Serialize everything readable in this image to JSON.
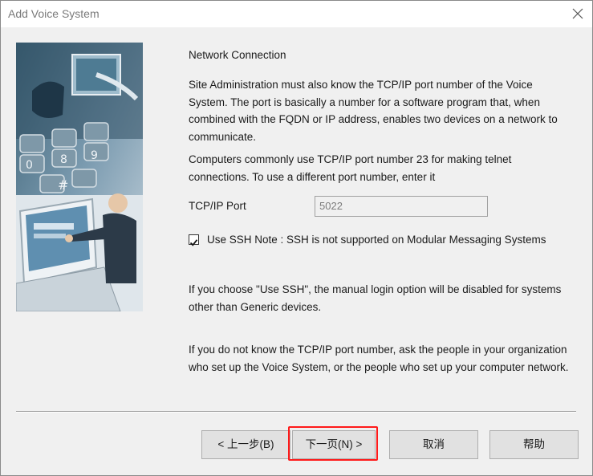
{
  "window": {
    "title": "Add Voice System",
    "close_icon": "close-icon"
  },
  "content": {
    "heading": "Network Connection",
    "paragraph1": "Site Administration must also know the TCP/IP port number of the Voice System.  The port is basically a number for a software program that, when combined with the FQDN or IP address, enables two devices on a network to communicate.",
    "paragraph2": "Computers commonly use TCP/IP port number 23 for making telnet connections.  To use a different port number, enter it",
    "port_label": "TCP/IP Port",
    "port_value": "5022",
    "ssh_checked": true,
    "ssh_label": "Use SSH Note : SSH is not supported on Modular Messaging Systems",
    "paragraph3": "If you choose \"Use SSH\", the manual login option will be disabled for systems other than Generic devices.",
    "paragraph4": "If you do not know the TCP/IP port number, ask the people in your organization who set up the Voice System, or the people who set up your computer network."
  },
  "buttons": {
    "back": "< 上一步(B)",
    "next": "下一页(N) >",
    "cancel": "取消",
    "help": "帮助"
  },
  "colors": {
    "highlight": "#ff1a1a",
    "dialog_bg": "#f0f0f0"
  }
}
